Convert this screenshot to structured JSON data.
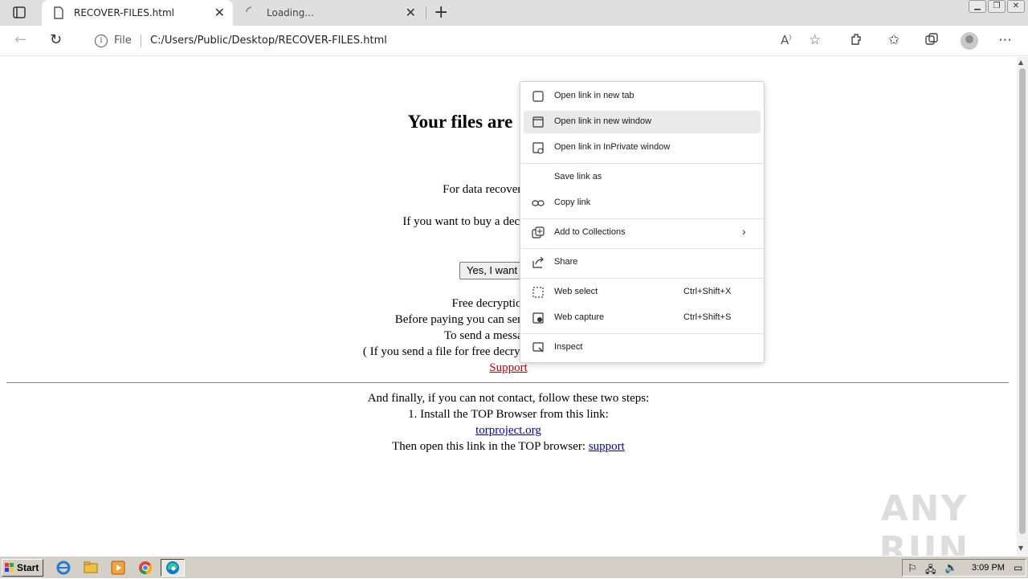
{
  "browser": {
    "tabs": [
      {
        "title": "RECOVER-FILES.html",
        "active": true
      },
      {
        "title": "Loading...",
        "active": false
      }
    ],
    "address": {
      "scheme_label": "File",
      "url": "C:/Users/Public/Desktop/RECOVER-FILES.html"
    }
  },
  "page": {
    "heading": "Your files are",
    "lines": {
      "recovery": "For data recovery ne",
      "buy": "If you want to buy a decry",
      "free_decryption": "Free decryption a",
      "before_paying": "Before paying you can send us",
      "send_message": "To send a message or",
      "if_you_send": "( If you send a file for free decryption, also",
      "finally": "And finally, if you can not contact, follow these two steps:",
      "install": "1. Install the TOP Browser from this link:",
      "then_open": "Then open this link in the TOP browser:"
    },
    "yes_button": "Yes, I want",
    "support_link_red": "Support",
    "torproject_link": "torproject.org",
    "support_link_blue": "support"
  },
  "context_menu": {
    "items": [
      {
        "label": "Open link in new tab",
        "icon": "new-tab-icon"
      },
      {
        "label": "Open link in new window",
        "icon": "new-window-icon"
      },
      {
        "label": "Open link in InPrivate window",
        "icon": "inprivate-icon"
      },
      {
        "label": "Save link as",
        "icon": ""
      },
      {
        "label": "Copy link",
        "icon": "link-icon"
      },
      {
        "label": "Add to Collections",
        "icon": "collections-icon"
      },
      {
        "label": "Share",
        "icon": "share-icon"
      },
      {
        "label": "Web select",
        "icon": "web-select-icon",
        "shortcut": "Ctrl+Shift+X"
      },
      {
        "label": "Web capture",
        "icon": "web-capture-icon",
        "shortcut": "Ctrl+Shift+S"
      },
      {
        "label": "Inspect",
        "icon": "inspect-icon"
      }
    ]
  },
  "taskbar": {
    "start_label": "Start",
    "clock": "3:09 PM"
  },
  "watermark": "ANY RUN",
  "colors": {
    "link_red": "#c00000",
    "link_blue": "#0000cc",
    "hover_bg": "#eaeaea"
  }
}
